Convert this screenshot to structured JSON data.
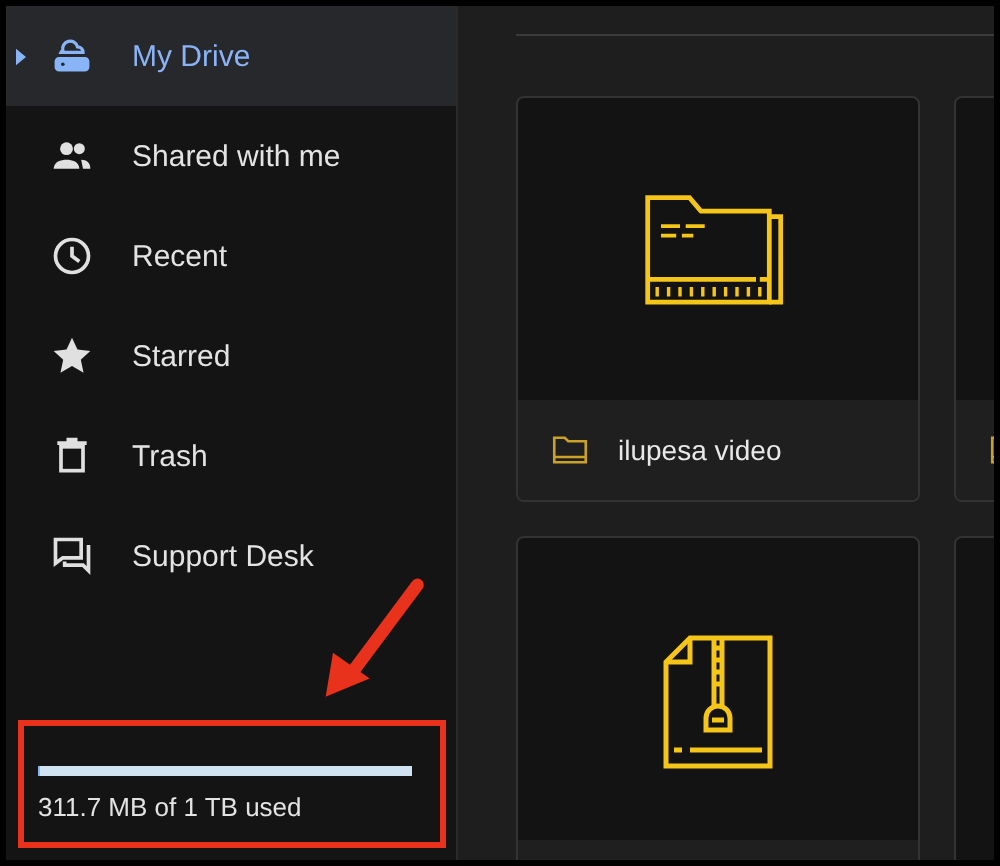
{
  "sidebar": {
    "items": [
      {
        "kind": "drive",
        "label": "My Drive",
        "selected": true
      },
      {
        "kind": "shared",
        "label": "Shared with me",
        "selected": false
      },
      {
        "kind": "recent",
        "label": "Recent",
        "selected": false
      },
      {
        "kind": "starred",
        "label": "Starred",
        "selected": false
      },
      {
        "kind": "trash",
        "label": "Trash",
        "selected": false
      },
      {
        "kind": "support",
        "label": "Support Desk",
        "selected": false
      }
    ],
    "storage": {
      "level": 0.003,
      "text": "311.7 MB of 1 TB used"
    }
  },
  "cards": [
    {
      "kind": "folder",
      "name": "ilupesa video"
    },
    {
      "kind": "folder"
    },
    {
      "kind": "zip"
    }
  ]
}
